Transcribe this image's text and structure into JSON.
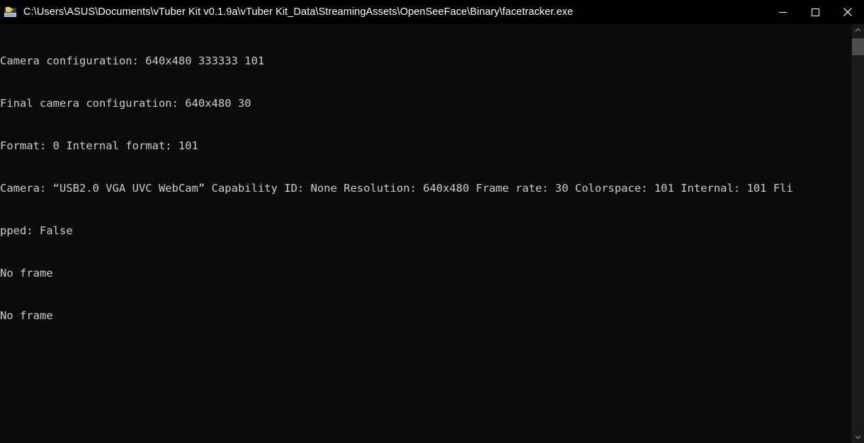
{
  "window": {
    "title": "C:\\Users\\ASUS\\Documents\\vTuber Kit v0.1.9a\\vTuber Kit_Data\\StreamingAssets\\OpenSeeFace\\Binary\\facetracker.exe",
    "icon": "console-application-icon",
    "background_color": "#0c0c0c",
    "titlebar_color": "#000000",
    "title_text_color": "#ffffff"
  },
  "window_controls": {
    "minimize": {
      "label": "Minimize",
      "icon": "minimize-icon"
    },
    "maximize": {
      "label": "Maximize",
      "icon": "maximize-icon"
    },
    "close": {
      "label": "Close",
      "icon": "close-icon"
    }
  },
  "console": {
    "text_color": "#cccccc",
    "lines": [
      "Camera configuration: 640x480 333333 101",
      "Final camera configuration: 640x480 30",
      "Format: 0 Internal format: 101",
      "Camera: “USB2.0 VGA UVC WebCam” Capability ID: None Resolution: 640x480 Frame rate: 30 Colorspace: 101 Internal: 101 Fli",
      "pped: False",
      "No frame",
      "No frame"
    ]
  },
  "scrollbar": {
    "up_arrow": {
      "icon": "chevron-up-icon"
    },
    "down_arrow": {
      "icon": "chevron-down-icon"
    },
    "thumb": {
      "name": "scrollbar-thumb",
      "color": "#4d4d4d"
    },
    "track_color": "#1a1a1a"
  }
}
